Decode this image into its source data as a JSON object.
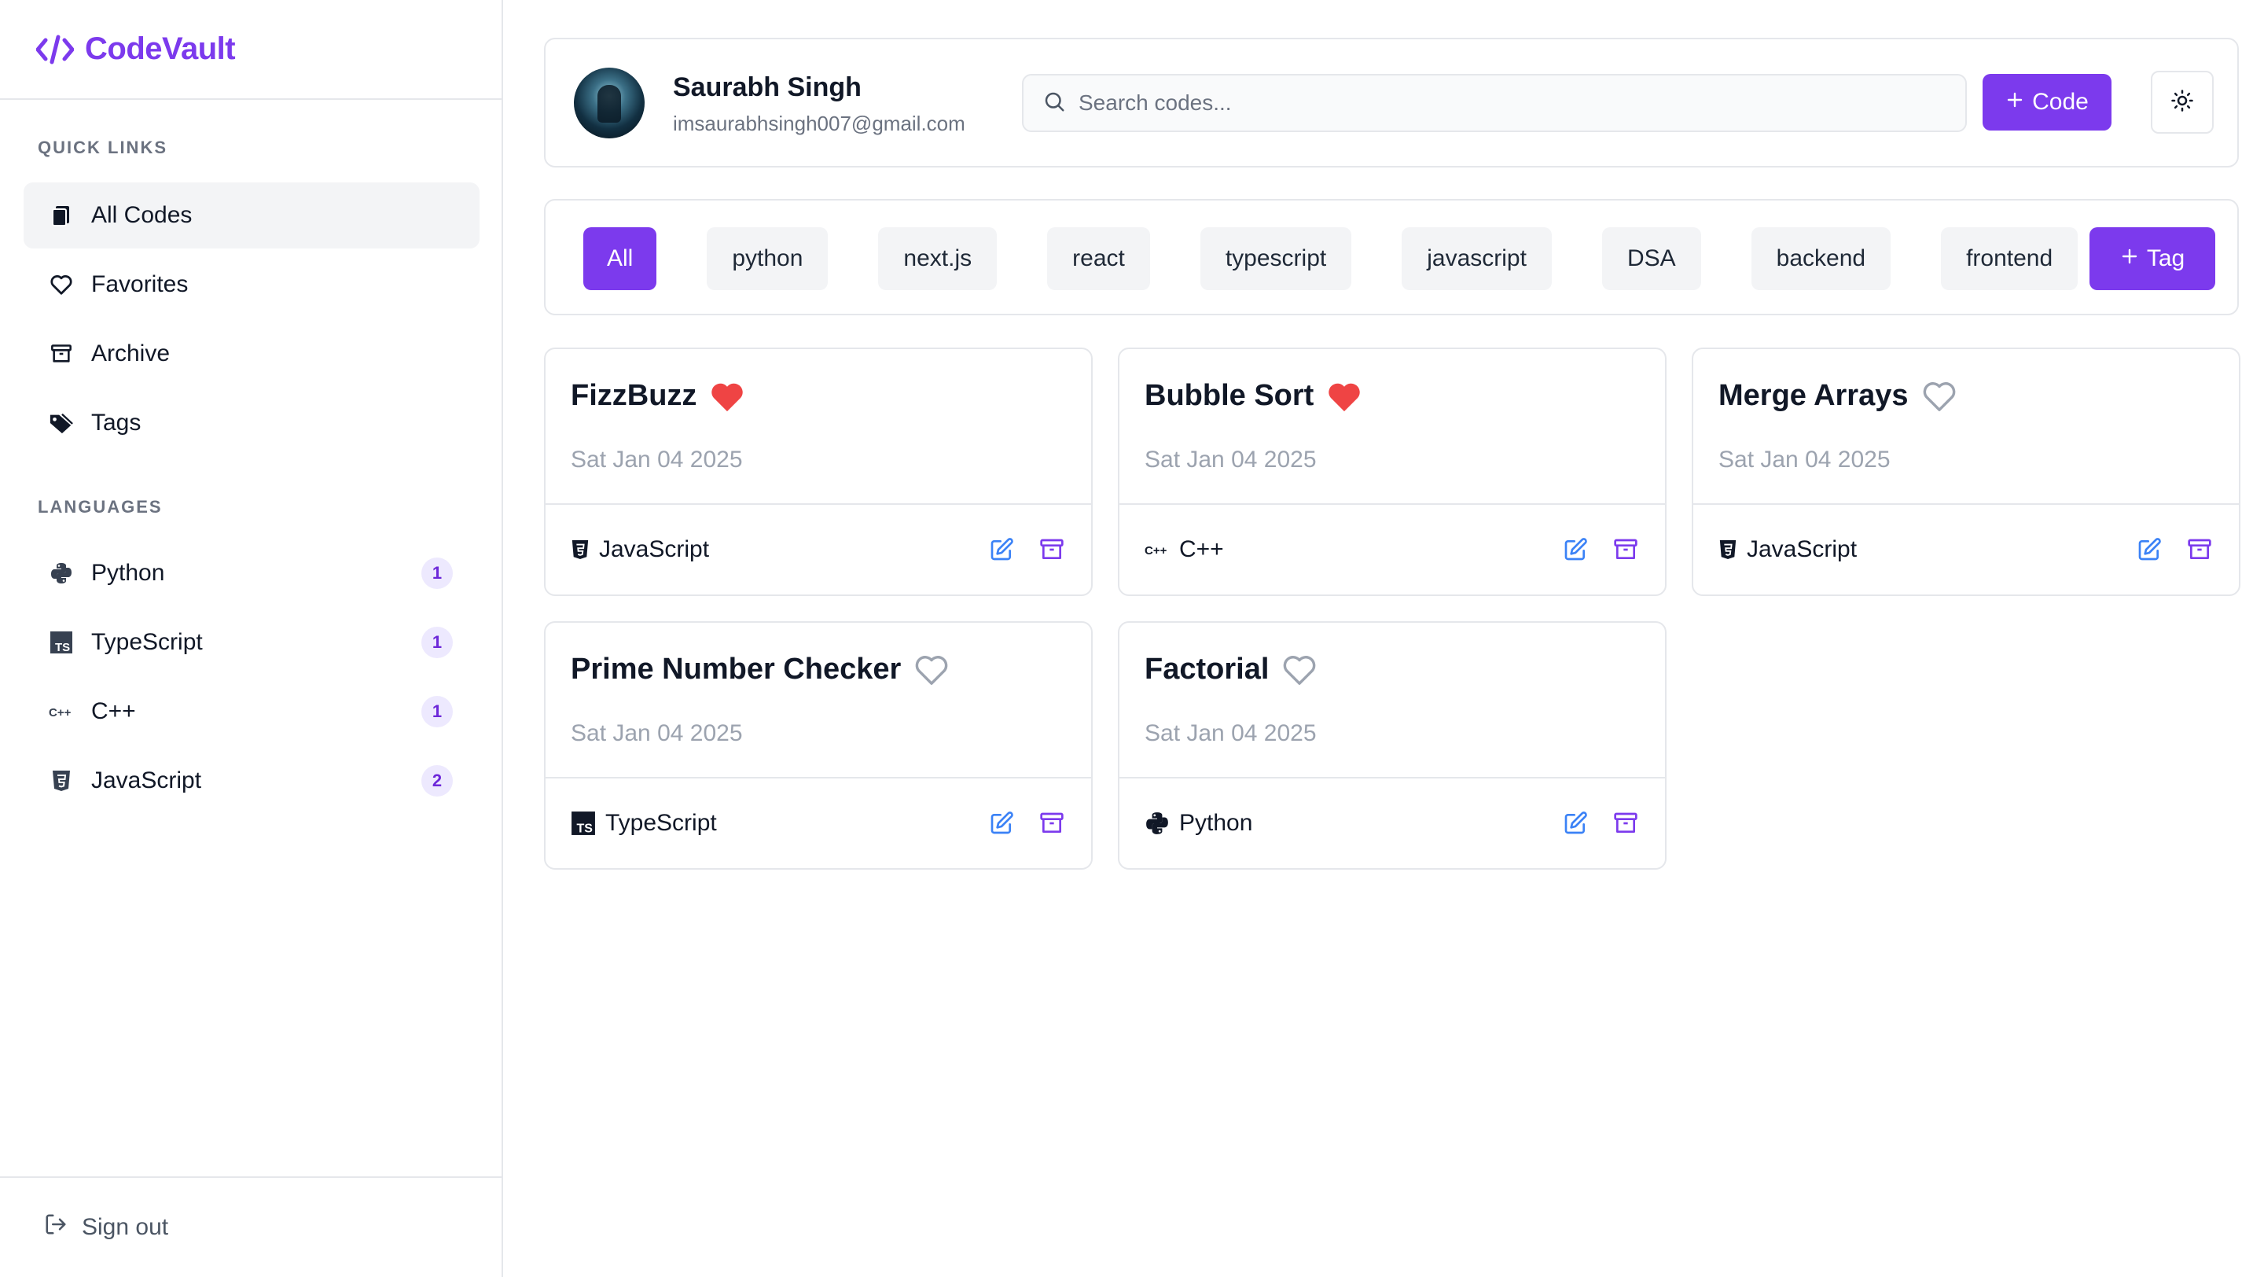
{
  "app": {
    "name": "CodeVault"
  },
  "sidebar": {
    "quick_links_title": "QUICK LINKS",
    "quick_links": [
      {
        "label": "All Codes",
        "icon": "copy-icon",
        "active": true
      },
      {
        "label": "Favorites",
        "icon": "heart-icon"
      },
      {
        "label": "Archive",
        "icon": "archive-icon"
      },
      {
        "label": "Tags",
        "icon": "tags-icon"
      }
    ],
    "languages_title": "LANGUAGES",
    "languages": [
      {
        "label": "Python",
        "icon": "python-icon",
        "count": "1"
      },
      {
        "label": "TypeScript",
        "icon": "typescript-icon",
        "count": "1"
      },
      {
        "label": "C++",
        "icon": "cplusplus-icon",
        "count": "1"
      },
      {
        "label": "JavaScript",
        "icon": "javascript-icon",
        "count": "2"
      }
    ],
    "sign_out_label": "Sign out"
  },
  "header": {
    "user_name": "Saurabh Singh",
    "user_email": "imsaurabhsingh007@gmail.com",
    "search_placeholder": "Search codes...",
    "add_code_label": "Code"
  },
  "tagbar": {
    "tags": [
      "All",
      "python",
      "next.js",
      "react",
      "typescript",
      "javascript",
      "DSA",
      "backend",
      "frontend"
    ],
    "active_tag": "All",
    "add_tag_label": "Tag"
  },
  "cards": [
    {
      "title": "FizzBuzz",
      "favorite": true,
      "date": "Sat Jan 04 2025",
      "language": "JavaScript",
      "lang_icon": "javascript-icon"
    },
    {
      "title": "Bubble Sort",
      "favorite": true,
      "date": "Sat Jan 04 2025",
      "language": "C++",
      "lang_icon": "cplusplus-icon"
    },
    {
      "title": "Merge Arrays",
      "favorite": false,
      "date": "Sat Jan 04 2025",
      "language": "JavaScript",
      "lang_icon": "javascript-icon"
    },
    {
      "title": "Prime Number Checker",
      "favorite": false,
      "date": "Sat Jan 04 2025",
      "language": "TypeScript",
      "lang_icon": "typescript-icon"
    },
    {
      "title": "Factorial",
      "favorite": false,
      "date": "Sat Jan 04 2025",
      "language": "Python",
      "lang_icon": "python-icon"
    }
  ],
  "colors": {
    "accent": "#7c3aed",
    "favorite": "#ef4444",
    "edit_icon": "#3b82f6",
    "archive_icon": "#7c3aed"
  }
}
